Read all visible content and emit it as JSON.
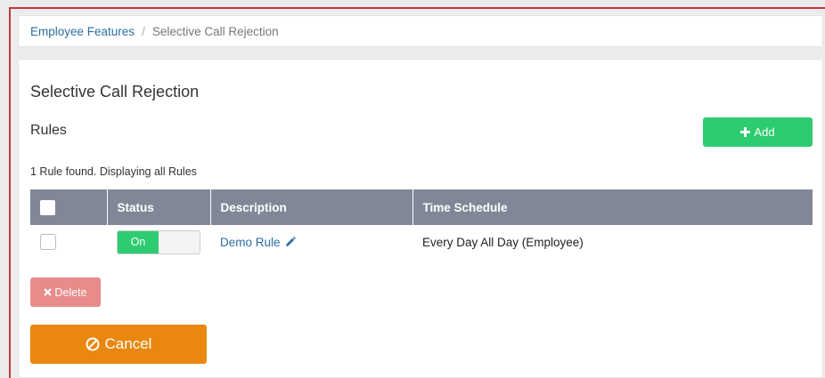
{
  "breadcrumb": {
    "parent": "Employee Features",
    "separator": "/",
    "current": "Selective Call Rejection"
  },
  "page": {
    "title": "Selective Call Rejection",
    "section_title": "Rules",
    "add_label": "Add",
    "count_text": "1 Rule found. Displaying all Rules"
  },
  "table": {
    "headers": [
      "Status",
      "Description",
      "Time Schedule"
    ],
    "rows": [
      {
        "checked": false,
        "status": "On",
        "description": "Demo Rule",
        "time_schedule": "Every Day All Day (Employee)"
      }
    ]
  },
  "actions": {
    "delete_label": "Delete",
    "cancel_label": "Cancel"
  },
  "colors": {
    "accent_green": "#2ecc71",
    "header_gray": "#808898",
    "delete_red": "#e88b8b",
    "cancel_orange": "#ea870e",
    "link_blue": "#2e6da4"
  }
}
